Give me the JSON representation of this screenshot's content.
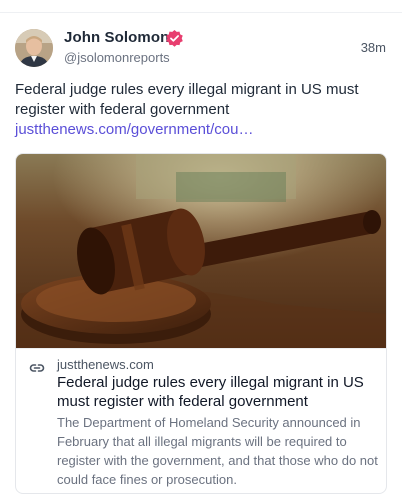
{
  "post": {
    "author_name": "John Solomon",
    "handle": "@jsolomonreports",
    "timestamp": "38m",
    "text": "Federal judge rules every illegal migrant in US must register with federal government ",
    "link_text": "justthenews.com/government/cou…"
  },
  "card": {
    "domain": "justthenews.com",
    "title": "Federal judge rules every illegal migrant in US must register with federal government",
    "description": "The Department of Homeland Security announced in February that all illegal migrants will be required to register with the government, and that those who do not could face fines or prosecution."
  },
  "icons": {
    "verified": "verified-badge-icon",
    "link": "link-icon"
  },
  "colors": {
    "link": "#5b4fd8",
    "verified": "#e83e6f"
  }
}
